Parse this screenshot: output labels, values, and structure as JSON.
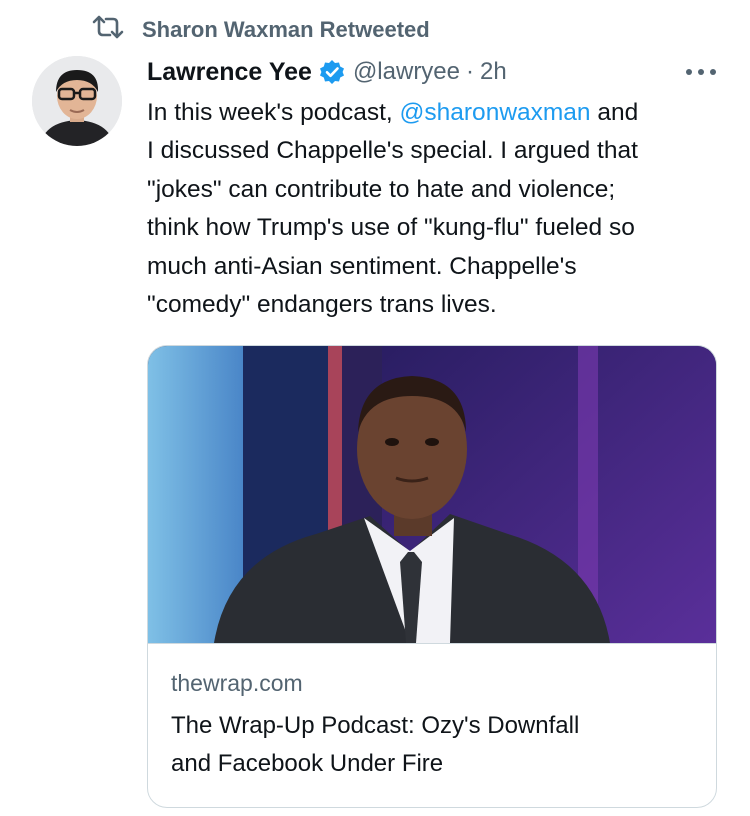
{
  "retweet": {
    "icon": "retweet-icon",
    "text": "Sharon Waxman Retweeted"
  },
  "tweet": {
    "author_name": "Lawrence Yee",
    "verified_icon": "verified-badge-icon",
    "handle": "@lawryee",
    "separator": "·",
    "time": "2h",
    "more_icon": "more-options-icon",
    "text_lines": {
      "l1_a": "In this week's podcast, ",
      "l1_mention": "@sharonwaxman",
      "l1_b": " and",
      "l2": "I discussed Chappelle's special. I argued that",
      "l3": "\"jokes\" can contribute to hate and violence;",
      "l4": "think how Trump's use of \"kung-flu\" fueled so",
      "l5": "much anti-Asian sentiment. Chappelle's",
      "l6": "\"comedy\" endangers trans lives."
    }
  },
  "card": {
    "domain": "thewrap.com",
    "title_line1": "The Wrap-Up Podcast: Ozy's Downfall",
    "title_line2": "and Facebook Under Fire"
  },
  "colors": {
    "link": "#1d9bf0",
    "secondary": "#536471",
    "border": "#cfd9de",
    "verified": "#1d9bf0"
  }
}
